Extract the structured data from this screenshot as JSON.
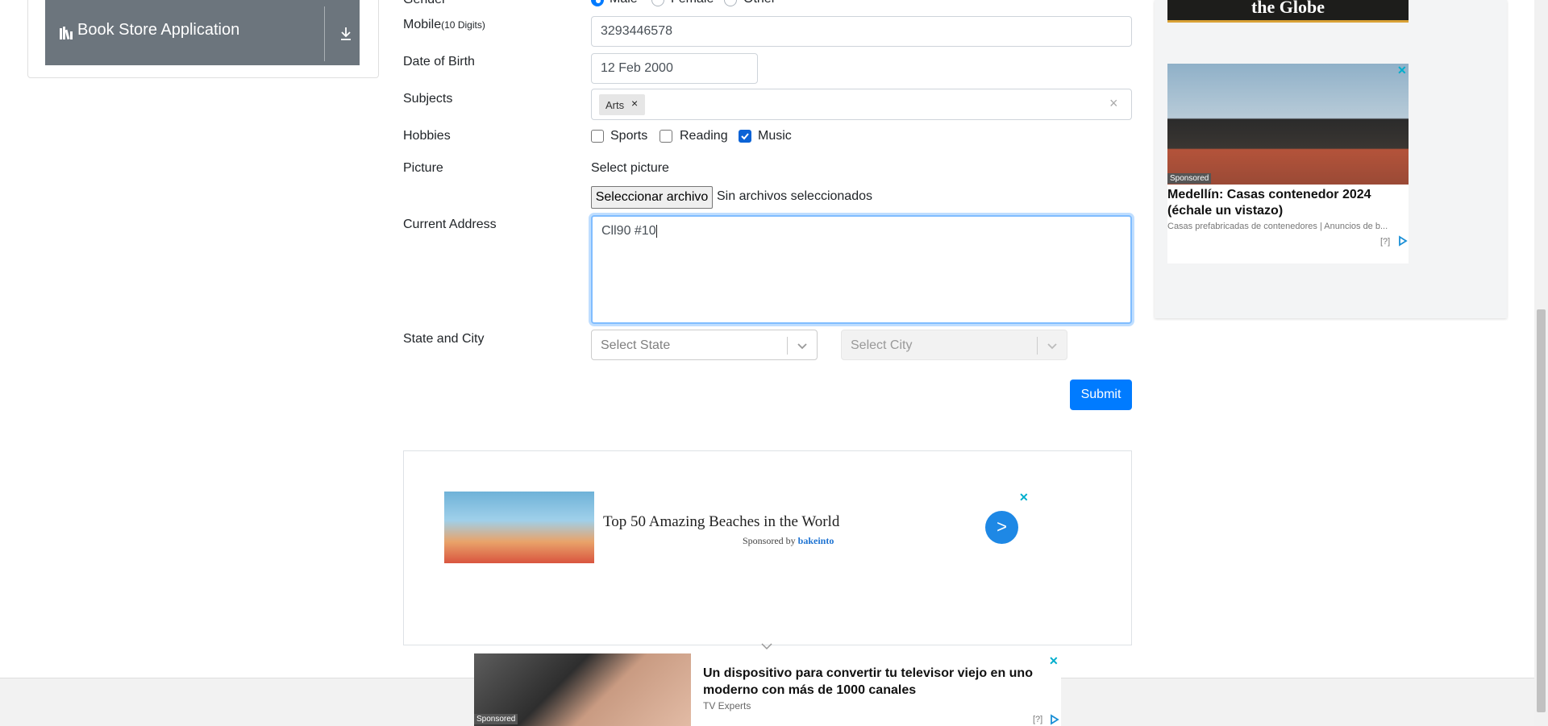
{
  "sidebar": {
    "book_store_label": "Book Store Application"
  },
  "form": {
    "gender": {
      "label": "Gender",
      "options": [
        "Male",
        "Female",
        "Other"
      ],
      "selected": "Male"
    },
    "mobile": {
      "label": "Mobile",
      "hint": "(10 Digits)",
      "value": "3293446578"
    },
    "dob": {
      "label": "Date of Birth",
      "value": "12 Feb 2000"
    },
    "subjects": {
      "label": "Subjects",
      "chips": [
        "Arts"
      ],
      "clear_glyph": "×"
    },
    "hobbies": {
      "label": "Hobbies",
      "items": [
        {
          "label": "Sports",
          "checked": false
        },
        {
          "label": "Reading",
          "checked": false
        },
        {
          "label": "Music",
          "checked": true
        }
      ]
    },
    "picture": {
      "label": "Picture",
      "select_label": "Select picture",
      "button": "Seleccionar archivo",
      "status": "Sin archivos seleccionados"
    },
    "address": {
      "label": "Current Address",
      "value": "Cll90 #10"
    },
    "state_city": {
      "label": "State and City",
      "state_placeholder": "Select State",
      "city_placeholder": "Select City"
    },
    "submit_label": "Submit"
  },
  "ads": {
    "banner": {
      "title": "Top 50 Amazing Beaches in the World",
      "sponsored_prefix": "Sponsored by",
      "sponsor": "bakeinto",
      "go": ">"
    },
    "globe_text": "the Globe",
    "house": {
      "sponsored": "Sponsored",
      "title": "Medellín: Casas contenedor 2024 (échale un vistazo)",
      "subtitle": "Casas prefabricadas de contenedores | Anuncios de b...",
      "help": "[?]"
    },
    "bottom": {
      "sponsored": "Sponsored",
      "title": "Un dispositivo para convertir tu televisor viejo en uno moderno con más de 1000 canales",
      "source": "TV Experts",
      "help": "[?]"
    },
    "close_glyph": "✕"
  },
  "colors": {
    "primary": "#007bff",
    "sidebar_group": "#6c757d",
    "ad_accent": "#00aecd"
  }
}
